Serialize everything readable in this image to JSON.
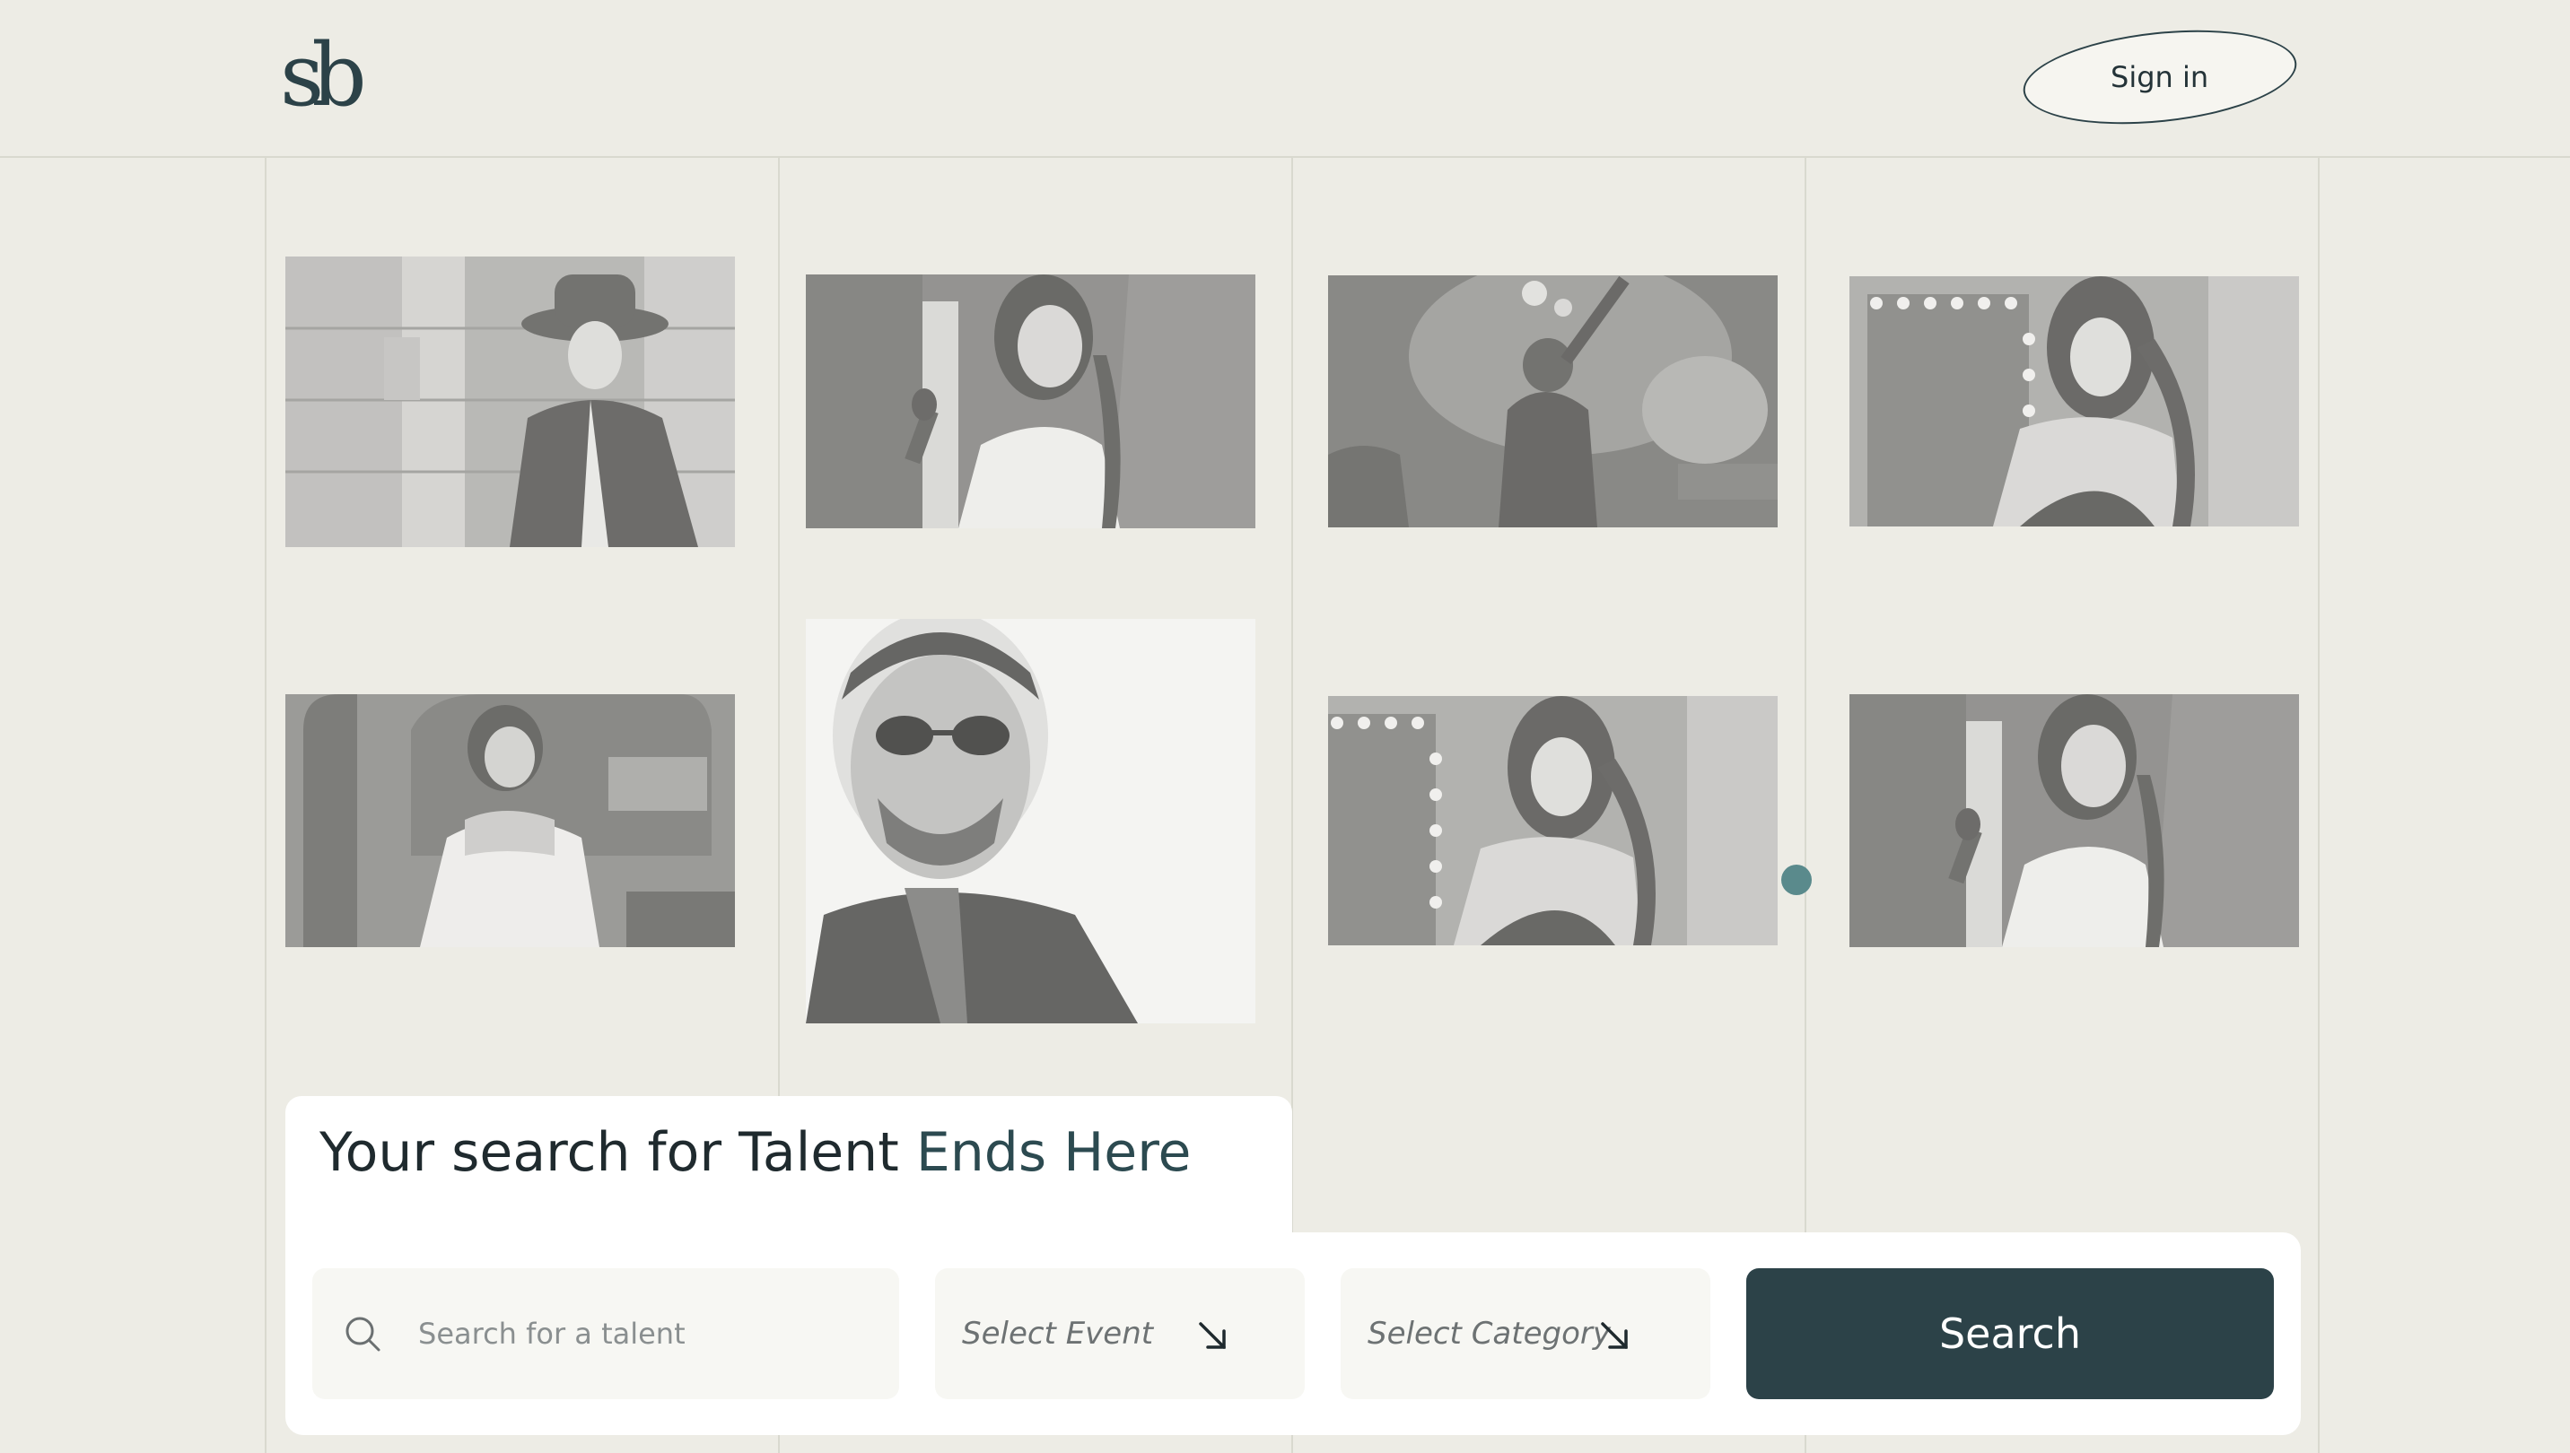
{
  "header": {
    "logo_text": "sb",
    "signin_label": "Sign in"
  },
  "hero": {
    "headline_plain": "Your search for Talent ",
    "headline_accent": "Ends Here"
  },
  "search": {
    "talent_placeholder": "Search for a talent",
    "event_label": "Select Event",
    "category_label": "Select Category",
    "button_label": "Search"
  },
  "photos": [
    {
      "name": "photo-woman-hat"
    },
    {
      "name": "photo-woman-microphone"
    },
    {
      "name": "photo-band-stage"
    },
    {
      "name": "photo-woman-mirror"
    },
    {
      "name": "photo-woman-white-dress"
    },
    {
      "name": "photo-man-sunglasses"
    },
    {
      "name": "photo-woman-mirror-2"
    },
    {
      "name": "photo-woman-microphone-2"
    }
  ],
  "colors": {
    "background": "#edece5",
    "accent": "#2c4248",
    "dot": "#5a8a8c"
  }
}
